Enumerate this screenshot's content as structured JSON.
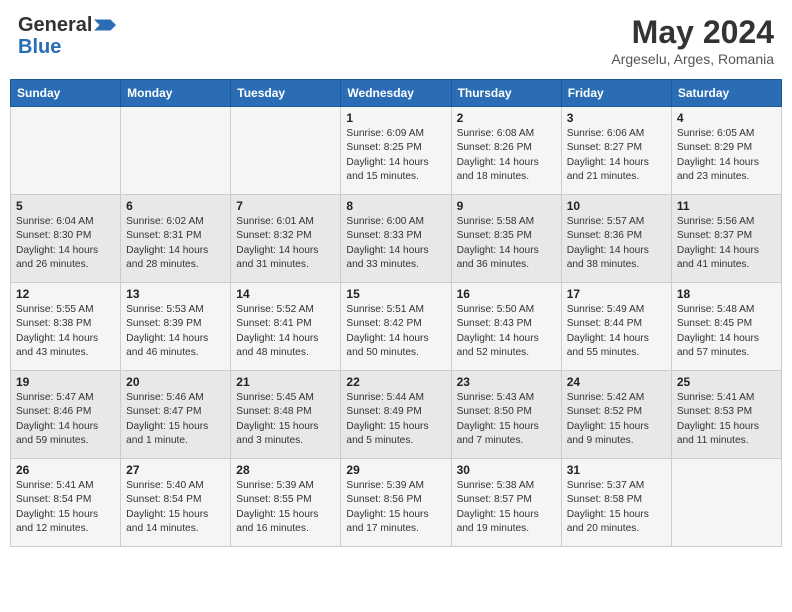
{
  "header": {
    "logo_general": "General",
    "logo_blue": "Blue",
    "month_year": "May 2024",
    "location": "Argeselu, Arges, Romania"
  },
  "weekdays": [
    "Sunday",
    "Monday",
    "Tuesday",
    "Wednesday",
    "Thursday",
    "Friday",
    "Saturday"
  ],
  "weeks": [
    [
      {
        "day": "",
        "sunrise": "",
        "sunset": "",
        "daylight": ""
      },
      {
        "day": "",
        "sunrise": "",
        "sunset": "",
        "daylight": ""
      },
      {
        "day": "",
        "sunrise": "",
        "sunset": "",
        "daylight": ""
      },
      {
        "day": "1",
        "sunrise": "Sunrise: 6:09 AM",
        "sunset": "Sunset: 8:25 PM",
        "daylight": "Daylight: 14 hours and 15 minutes."
      },
      {
        "day": "2",
        "sunrise": "Sunrise: 6:08 AM",
        "sunset": "Sunset: 8:26 PM",
        "daylight": "Daylight: 14 hours and 18 minutes."
      },
      {
        "day": "3",
        "sunrise": "Sunrise: 6:06 AM",
        "sunset": "Sunset: 8:27 PM",
        "daylight": "Daylight: 14 hours and 21 minutes."
      },
      {
        "day": "4",
        "sunrise": "Sunrise: 6:05 AM",
        "sunset": "Sunset: 8:29 PM",
        "daylight": "Daylight: 14 hours and 23 minutes."
      }
    ],
    [
      {
        "day": "5",
        "sunrise": "Sunrise: 6:04 AM",
        "sunset": "Sunset: 8:30 PM",
        "daylight": "Daylight: 14 hours and 26 minutes."
      },
      {
        "day": "6",
        "sunrise": "Sunrise: 6:02 AM",
        "sunset": "Sunset: 8:31 PM",
        "daylight": "Daylight: 14 hours and 28 minutes."
      },
      {
        "day": "7",
        "sunrise": "Sunrise: 6:01 AM",
        "sunset": "Sunset: 8:32 PM",
        "daylight": "Daylight: 14 hours and 31 minutes."
      },
      {
        "day": "8",
        "sunrise": "Sunrise: 6:00 AM",
        "sunset": "Sunset: 8:33 PM",
        "daylight": "Daylight: 14 hours and 33 minutes."
      },
      {
        "day": "9",
        "sunrise": "Sunrise: 5:58 AM",
        "sunset": "Sunset: 8:35 PM",
        "daylight": "Daylight: 14 hours and 36 minutes."
      },
      {
        "day": "10",
        "sunrise": "Sunrise: 5:57 AM",
        "sunset": "Sunset: 8:36 PM",
        "daylight": "Daylight: 14 hours and 38 minutes."
      },
      {
        "day": "11",
        "sunrise": "Sunrise: 5:56 AM",
        "sunset": "Sunset: 8:37 PM",
        "daylight": "Daylight: 14 hours and 41 minutes."
      }
    ],
    [
      {
        "day": "12",
        "sunrise": "Sunrise: 5:55 AM",
        "sunset": "Sunset: 8:38 PM",
        "daylight": "Daylight: 14 hours and 43 minutes."
      },
      {
        "day": "13",
        "sunrise": "Sunrise: 5:53 AM",
        "sunset": "Sunset: 8:39 PM",
        "daylight": "Daylight: 14 hours and 46 minutes."
      },
      {
        "day": "14",
        "sunrise": "Sunrise: 5:52 AM",
        "sunset": "Sunset: 8:41 PM",
        "daylight": "Daylight: 14 hours and 48 minutes."
      },
      {
        "day": "15",
        "sunrise": "Sunrise: 5:51 AM",
        "sunset": "Sunset: 8:42 PM",
        "daylight": "Daylight: 14 hours and 50 minutes."
      },
      {
        "day": "16",
        "sunrise": "Sunrise: 5:50 AM",
        "sunset": "Sunset: 8:43 PM",
        "daylight": "Daylight: 14 hours and 52 minutes."
      },
      {
        "day": "17",
        "sunrise": "Sunrise: 5:49 AM",
        "sunset": "Sunset: 8:44 PM",
        "daylight": "Daylight: 14 hours and 55 minutes."
      },
      {
        "day": "18",
        "sunrise": "Sunrise: 5:48 AM",
        "sunset": "Sunset: 8:45 PM",
        "daylight": "Daylight: 14 hours and 57 minutes."
      }
    ],
    [
      {
        "day": "19",
        "sunrise": "Sunrise: 5:47 AM",
        "sunset": "Sunset: 8:46 PM",
        "daylight": "Daylight: 14 hours and 59 minutes."
      },
      {
        "day": "20",
        "sunrise": "Sunrise: 5:46 AM",
        "sunset": "Sunset: 8:47 PM",
        "daylight": "Daylight: 15 hours and 1 minute."
      },
      {
        "day": "21",
        "sunrise": "Sunrise: 5:45 AM",
        "sunset": "Sunset: 8:48 PM",
        "daylight": "Daylight: 15 hours and 3 minutes."
      },
      {
        "day": "22",
        "sunrise": "Sunrise: 5:44 AM",
        "sunset": "Sunset: 8:49 PM",
        "daylight": "Daylight: 15 hours and 5 minutes."
      },
      {
        "day": "23",
        "sunrise": "Sunrise: 5:43 AM",
        "sunset": "Sunset: 8:50 PM",
        "daylight": "Daylight: 15 hours and 7 minutes."
      },
      {
        "day": "24",
        "sunrise": "Sunrise: 5:42 AM",
        "sunset": "Sunset: 8:52 PM",
        "daylight": "Daylight: 15 hours and 9 minutes."
      },
      {
        "day": "25",
        "sunrise": "Sunrise: 5:41 AM",
        "sunset": "Sunset: 8:53 PM",
        "daylight": "Daylight: 15 hours and 11 minutes."
      }
    ],
    [
      {
        "day": "26",
        "sunrise": "Sunrise: 5:41 AM",
        "sunset": "Sunset: 8:54 PM",
        "daylight": "Daylight: 15 hours and 12 minutes."
      },
      {
        "day": "27",
        "sunrise": "Sunrise: 5:40 AM",
        "sunset": "Sunset: 8:54 PM",
        "daylight": "Daylight: 15 hours and 14 minutes."
      },
      {
        "day": "28",
        "sunrise": "Sunrise: 5:39 AM",
        "sunset": "Sunset: 8:55 PM",
        "daylight": "Daylight: 15 hours and 16 minutes."
      },
      {
        "day": "29",
        "sunrise": "Sunrise: 5:39 AM",
        "sunset": "Sunset: 8:56 PM",
        "daylight": "Daylight: 15 hours and 17 minutes."
      },
      {
        "day": "30",
        "sunrise": "Sunrise: 5:38 AM",
        "sunset": "Sunset: 8:57 PM",
        "daylight": "Daylight: 15 hours and 19 minutes."
      },
      {
        "day": "31",
        "sunrise": "Sunrise: 5:37 AM",
        "sunset": "Sunset: 8:58 PM",
        "daylight": "Daylight: 15 hours and 20 minutes."
      },
      {
        "day": "",
        "sunrise": "",
        "sunset": "",
        "daylight": ""
      }
    ]
  ]
}
